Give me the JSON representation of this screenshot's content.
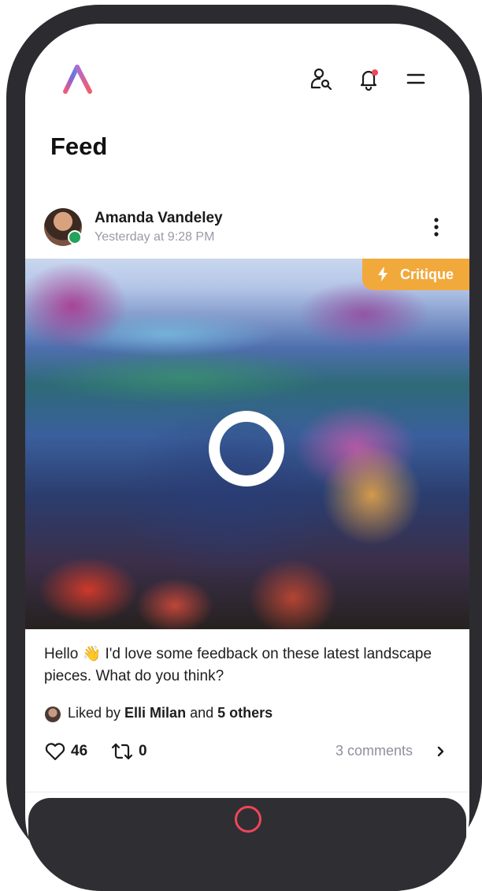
{
  "header": {
    "page_title": "Feed",
    "icons": [
      "app-logo",
      "user-search-icon",
      "bell-icon",
      "menu-icon"
    ],
    "notification_dot_color": "#f0455a"
  },
  "post": {
    "author_name": "Amanda Vandeley",
    "timestamp": "Yesterday at 9:28 PM",
    "badge": {
      "label": "Critique",
      "icon": "lightning-icon",
      "color": "#f2a93b"
    },
    "caption_text": "Hello 👋 I'd love some feedback on these latest landscape pieces. What do you think?",
    "likes": {
      "prefix": "Liked by ",
      "name": "Elli Milan",
      "joiner": " and ",
      "others": "5 others"
    },
    "like_count": "46",
    "repost_count": "0",
    "comments_label": "3 comments",
    "online_status_color": "#24a35a"
  }
}
